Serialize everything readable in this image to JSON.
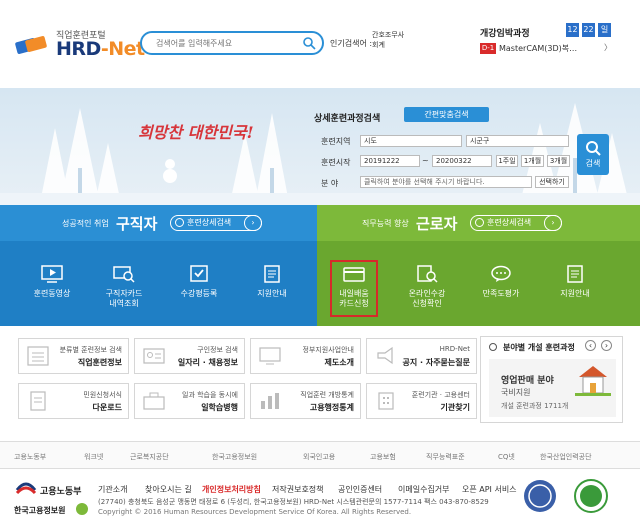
{
  "header": {
    "logo_sub": "직업훈련포털",
    "logo_main_a": "HRD",
    "logo_main_b": "-Net",
    "search_placeholder": "검색어를 입력해주세요",
    "popular_label": "인기검색어 :",
    "popular_items": [
      "간호조무사",
      "회계"
    ],
    "course_title": "개강임박과정",
    "dates": [
      "12",
      "22",
      "일"
    ],
    "course_tag": "D-1",
    "course_name": "MasterCAM(3D)복…",
    "course_next": "〉"
  },
  "hero": {
    "text": "희망찬 대한민국!",
    "detail_title": "상세훈련과정검색",
    "simple_search": "간편맞춤검색",
    "region_label": "훈련지역",
    "region_sel1": "시도",
    "region_sel2": "시군구",
    "period_label": "훈련시작",
    "date_from": "20191222",
    "date_to": "20200322",
    "date_sep": "~",
    "period_btns": [
      "1주일",
      "1개월",
      "3개월"
    ],
    "field_label": "분    야",
    "field_placeholder": "클릭하여 분야를 선택해 주시기 바랍니다.",
    "field_btn": "선택하기",
    "search_btn": "검색"
  },
  "band_blue": {
    "small": "성공적인 취업",
    "big": "구직자",
    "btn": "훈련상세검색"
  },
  "band_green": {
    "small": "직무능력 향상",
    "big": "근로자",
    "btn": "훈련상세검색"
  },
  "tiles_blue": [
    {
      "l1": "훈련동영상",
      "l2": ""
    },
    {
      "l1": "구직자카드",
      "l2": "내역조회"
    },
    {
      "l1": "수강평등록",
      "l2": ""
    },
    {
      "l1": "지원안내",
      "l2": ""
    }
  ],
  "tiles_green": [
    {
      "l1": "내일배움",
      "l2": "카드신청"
    },
    {
      "l1": "온라인수강",
      "l2": "신청확인"
    },
    {
      "l1": "만족도평가",
      "l2": ""
    },
    {
      "l1": "지원안내",
      "l2": ""
    }
  ],
  "cards": [
    {
      "l1": "분류별 훈련정보 검색",
      "l2": "직업훈련정보"
    },
    {
      "l1": "구인정보 검색",
      "l2": "일자리 · 채용정보"
    },
    {
      "l1": "정부지원사업안내",
      "l2": "제도소개"
    },
    {
      "l1": "HRD-Net",
      "l2": "공지 · 자주묻는질문"
    },
    {
      "l1": "민원신청서식",
      "l2": "다운로드"
    },
    {
      "l1": "일과 학습을 동시에",
      "l2": "일학습병행"
    },
    {
      "l1": "직업훈련 개방통계",
      "l2": "고용행정통계"
    },
    {
      "l1": "훈련기관 · 고용센터",
      "l2": "기관찾기"
    }
  ],
  "sched": {
    "title": "분야별 개설 훈련과정",
    "field": "영업판매 분야",
    "sub": "국비지원",
    "count": "개설 훈련과정 1711개"
  },
  "partners": [
    "고용노동부",
    "워크넷",
    "근로복지공단",
    "한국고용정보원",
    "외국인고용",
    "고용보험",
    "직무능력표준",
    "CQ넷",
    "한국산업인력공단"
  ],
  "footer": {
    "links": [
      "기관소개",
      "찾아오시는 길",
      "개인정보처리방침",
      "저작권보호정책",
      "공인인증센터",
      "이메일수집거부",
      "오픈 API 서비스"
    ],
    "address": "(27740) 충청북도 음성군 맹동면 태정로 6 (두성리, 한국고용정보원) HRD-Net 시스템관련문의 1577-7114   팩스 043-870-8529",
    "copyright": "Copyright © 2016 Human Resources Development Service Of Korea. All Rights Reserved.",
    "org1": "고용노동부",
    "org2": "한국고용정보원"
  },
  "colors": {
    "accent": "#2a8fd6",
    "blue_band": "#2b8fd4",
    "green_band": "#7db93a",
    "highlight": "#d62a2a"
  }
}
